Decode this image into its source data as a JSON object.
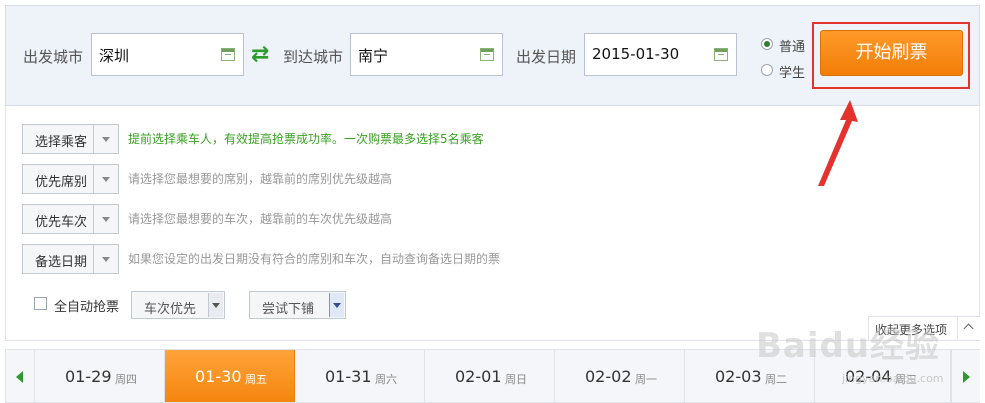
{
  "search": {
    "from_label": "出发城市",
    "from_value": "深圳",
    "to_label": "到达城市",
    "to_value": "南宁",
    "date_label": "出发日期",
    "date_value": "2015-01-30",
    "swap_icon": "⇄",
    "ticket_types": [
      {
        "label": "普通",
        "selected": true
      },
      {
        "label": "学生",
        "selected": false
      }
    ],
    "start_button": "开始刷票"
  },
  "options": {
    "rows": [
      {
        "button": "选择乘客",
        "hint": "提前选择乘车人，有效提高抢票成功率。一次购票最多选择5名乘客"
      },
      {
        "button": "优先席别",
        "hint": "请选择您最想要的席别，越靠前的席别优先级越高"
      },
      {
        "button": "优先车次",
        "hint": "请选择您最想要的车次，越靠前的车次优先级越高"
      },
      {
        "button": "备选日期",
        "hint": "如果您设定的出发日期没有符合的席别和车次，自动查询备选日期的票"
      }
    ],
    "auto_grab_label": "全自动抢票",
    "priority_select": "车次优先",
    "berth_select": "尝试下铺",
    "collapse_label": "收起更多选项"
  },
  "dates": [
    {
      "date": "01-29",
      "weekday": "周四",
      "active": false
    },
    {
      "date": "01-30",
      "weekday": "周五",
      "active": true
    },
    {
      "date": "01-31",
      "weekday": "周六",
      "active": false
    },
    {
      "date": "02-01",
      "weekday": "周日",
      "active": false
    },
    {
      "date": "02-02",
      "weekday": "周一",
      "active": false
    },
    {
      "date": "02-03",
      "weekday": "周二",
      "active": false
    },
    {
      "date": "02-04",
      "weekday": "周三",
      "active": false
    }
  ],
  "watermark": {
    "logo": "Baidu经验",
    "url": "jingyan.baidu.com"
  },
  "colors": {
    "accent_orange": "#f5860f",
    "green": "#2c9a2c",
    "annotation_red": "#e4322f"
  }
}
